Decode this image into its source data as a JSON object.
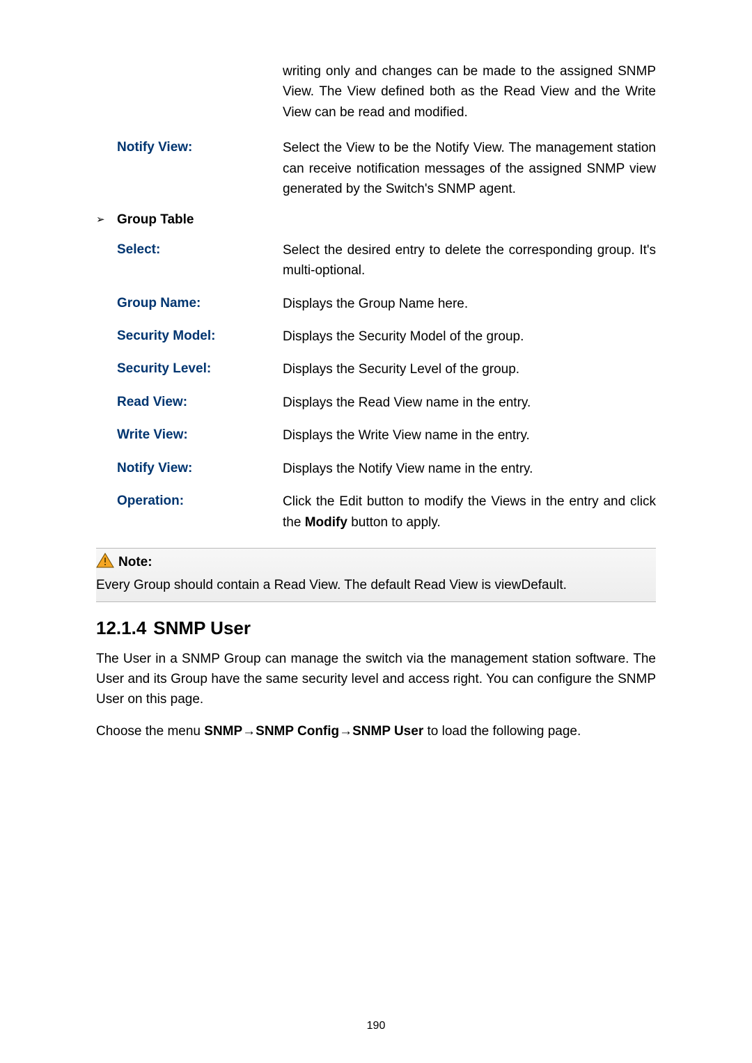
{
  "intro_continuation": "writing only and changes can be made to the assigned SNMP View. The View defined both as the Read View and the Write View can be read and modified.",
  "definitions_top": [
    {
      "label": "Notify View:",
      "value": "Select the View to be the Notify View. The management station can receive notification messages of the assigned SNMP view generated by the Switch's SNMP agent."
    }
  ],
  "group_table_heading_bullet": "➢",
  "group_table_heading": "Group Table",
  "group_table_defs": [
    {
      "label": "Select:",
      "value": "Select the desired entry to delete the corresponding group. It's multi-optional."
    },
    {
      "label": "Group Name:",
      "value": "Displays the Group Name here."
    },
    {
      "label": "Security Model:",
      "value": "Displays the Security Model of the group."
    },
    {
      "label": "Security Level:",
      "value": "Displays the Security Level of the group."
    },
    {
      "label": "Read View:",
      "value": "Displays the Read View name in the entry."
    },
    {
      "label": "Write View:",
      "value": "Displays the Write View name in the entry."
    },
    {
      "label": "Notify View:",
      "value": "Displays the Notify View name in the entry."
    },
    {
      "label": "Operation:",
      "value_html": "Click the Edit button to modify the Views in the entry and click the <b>Modify</b> button to apply."
    }
  ],
  "note": {
    "label": "Note:",
    "text": "Every Group should contain a Read View. The default Read View is viewDefault."
  },
  "section": {
    "number": "12.1.4",
    "title": "SNMP User"
  },
  "paragraph1": "The User in a SNMP Group can manage the switch via the management station software. The User and its Group have the same security level and access right. You can configure the SNMP User on this page.",
  "paragraph2_prefix": "Choose the menu ",
  "paragraph2_bold": "SNMP→SNMP Config→SNMP User",
  "paragraph2_suffix": " to load the following page.",
  "page_number": "190"
}
